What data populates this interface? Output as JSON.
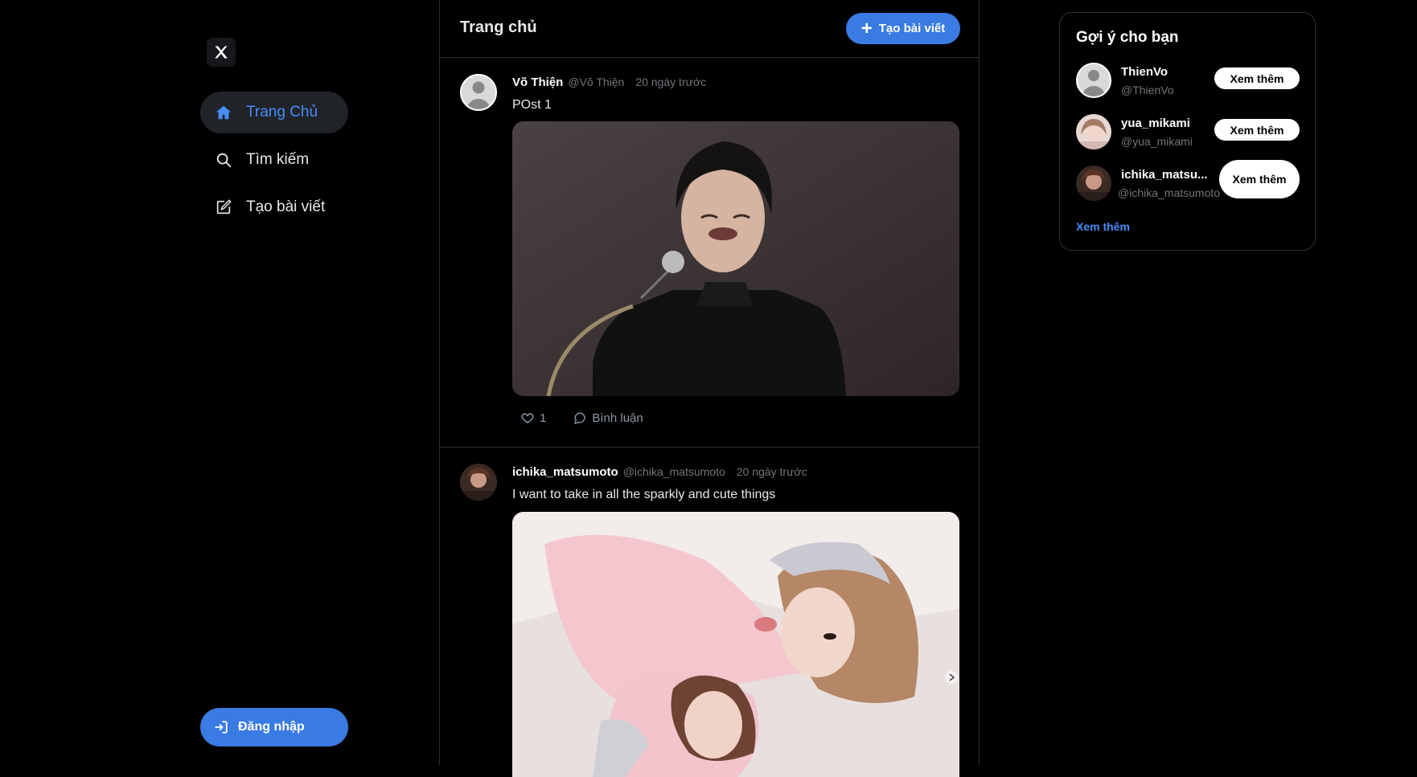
{
  "nav": {
    "items": [
      {
        "label": "Trang Chủ",
        "icon": "home-icon"
      },
      {
        "label": "Tìm kiếm",
        "icon": "search-icon"
      },
      {
        "label": "Tạo bài viết",
        "icon": "edit-icon"
      }
    ],
    "login_label": "Đăng nhập"
  },
  "header": {
    "title": "Trang chủ",
    "create_label": "Tạo bài viết"
  },
  "posts": [
    {
      "name": "Võ Thiện",
      "handle": "@Võ Thiện",
      "time": "20 ngày trước",
      "text": "POst 1",
      "likes": "1",
      "comment_label": "Bình luận"
    },
    {
      "name": "ichika_matsumoto",
      "handle": "@ichika_matsumoto",
      "time": "20 ngày trước",
      "text": "I want to take in all the sparkly and cute things"
    }
  ],
  "suggestions": {
    "title": "Gợi ý cho bạn",
    "users": [
      {
        "name": "ThienVo",
        "handle": "@ThienVo",
        "button": "Xem thêm"
      },
      {
        "name": "yua_mikami",
        "handle": "@yua_mikami",
        "button": "Xem thêm"
      },
      {
        "name": "ichika_matsu...",
        "handle": "@ichika_matsumoto",
        "button": "Xem thêm"
      }
    ],
    "see_more": "Xem thêm"
  },
  "colors": {
    "accent": "#3a7be3",
    "active_nav": "#4a8df8",
    "background": "#000000",
    "border": "#2f3336"
  }
}
